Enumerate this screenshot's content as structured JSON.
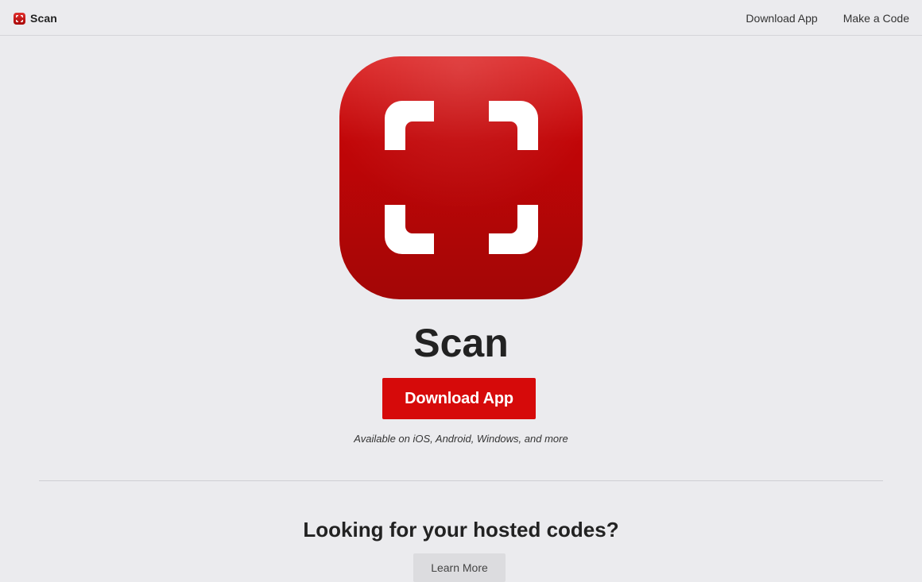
{
  "navbar": {
    "brand_name": "Scan",
    "links": [
      {
        "label": "Download App"
      },
      {
        "label": "Make a Code"
      }
    ]
  },
  "hero": {
    "icon": "scan-frame-icon",
    "title": "Scan",
    "download_label": "Download App",
    "availability": "Available on iOS, Android, Windows, and more"
  },
  "hosted": {
    "heading": "Looking for your hosted codes?",
    "learn_more_label": "Learn More"
  },
  "colors": {
    "brand_red": "#d60a0a",
    "background": "#ebebee",
    "secondary_button": "#dcdcdf"
  }
}
